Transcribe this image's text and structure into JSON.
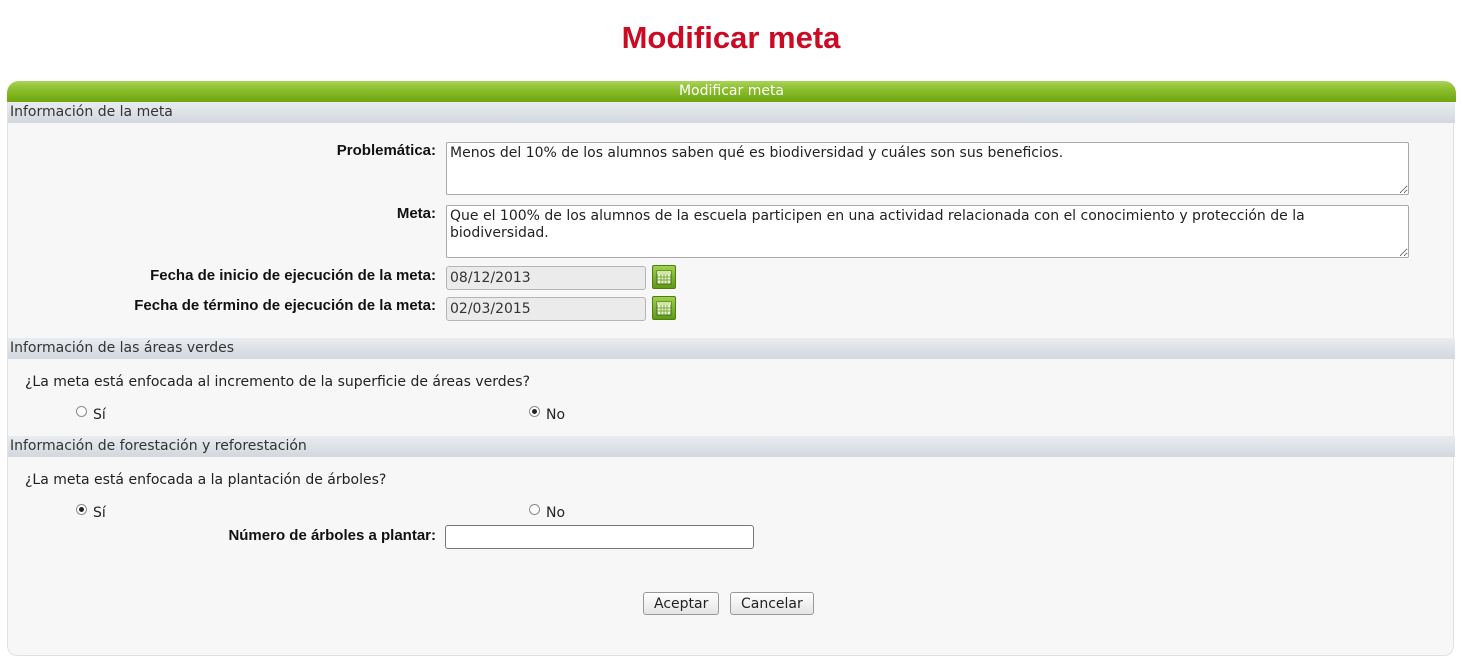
{
  "page": {
    "title": "Modificar meta"
  },
  "panel": {
    "header": "Modificar meta"
  },
  "sections": {
    "meta_info": {
      "title": "Información de la meta"
    },
    "green_areas": {
      "title": "Información de las áreas verdes"
    },
    "forestation": {
      "title": "Información de forestación y reforestación"
    }
  },
  "form": {
    "problematica": {
      "label": "Problemática:",
      "value": "Menos del 10% de los alumnos saben qué es biodiversidad y cuáles son sus beneficios."
    },
    "meta": {
      "label": "Meta:",
      "value": "Que el 100% de los alumnos de la escuela participen en una actividad relacionada con el conocimiento y protección de la biodiversidad."
    },
    "fecha_inicio": {
      "label": "Fecha de inicio de ejecución de la meta:",
      "value": "08/12/2013",
      "icon": "calendar-icon"
    },
    "fecha_termino": {
      "label": "Fecha de término de ejecución de la meta:",
      "value": "02/03/2015",
      "icon": "calendar-icon"
    },
    "areas_verdes": {
      "question": "¿La meta está enfocada al incremento de la superficie de áreas verdes?",
      "options": [
        "Sí",
        "No"
      ],
      "selected": "No"
    },
    "arboles": {
      "question": "¿La meta está enfocada a la plantación de árboles?",
      "options": [
        "Sí",
        "No"
      ],
      "selected": "Sí"
    },
    "numero_arboles": {
      "label": "Número de árboles a plantar:",
      "value": ""
    }
  },
  "buttons": {
    "accept": "Aceptar",
    "cancel": "Cancelar"
  },
  "colors": {
    "title": "#cc0a24",
    "header_green": "#8cbd2c",
    "section_bar": "#d9dee4"
  }
}
